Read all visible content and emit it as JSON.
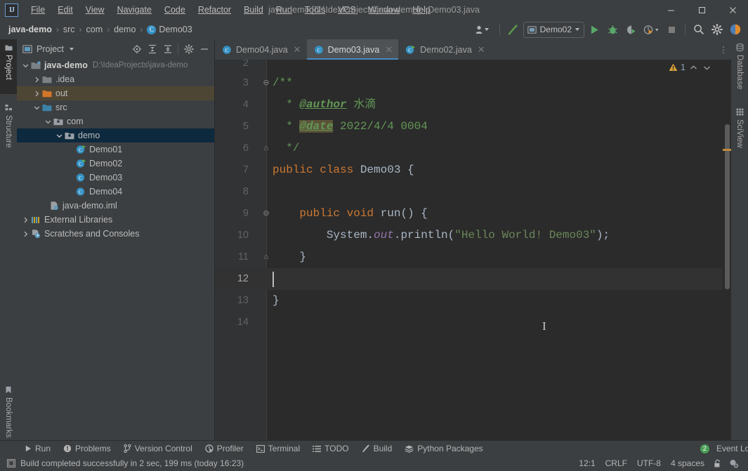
{
  "window": {
    "title": "java-demo [D:\\IdeaProjects\\java-demo] - Demo03.java",
    "minimize": "—",
    "maximize": "□",
    "close": "✕"
  },
  "menu": {
    "items": [
      {
        "label": "File"
      },
      {
        "label": "Edit"
      },
      {
        "label": "View"
      },
      {
        "label": "Navigate"
      },
      {
        "label": "Code"
      },
      {
        "label": "Refactor"
      },
      {
        "label": "Build"
      },
      {
        "label": "Run"
      },
      {
        "label": "Tools"
      },
      {
        "label": "VCS"
      },
      {
        "label": "Window"
      },
      {
        "label": "Help"
      }
    ]
  },
  "breadcrumb": {
    "separator": "›",
    "items": [
      {
        "label": "java-demo"
      },
      {
        "label": "src"
      },
      {
        "label": "com"
      },
      {
        "label": "demo"
      },
      {
        "label": "Demo03"
      }
    ]
  },
  "toolbar": {
    "run_config": "Demo02",
    "icons": [
      "user-settings-icon",
      "build-hammer-icon",
      "run-icon",
      "debug-icon",
      "run-with-coverage-icon",
      "profiler-icon",
      "stop-icon",
      "search-everywhere-icon",
      "settings-gear-icon",
      "ide-assistant-icon"
    ]
  },
  "left_stripe": {
    "items": [
      {
        "label": "Project",
        "icon": "project-folder-icon",
        "active": true
      },
      {
        "label": "Structure",
        "icon": "structure-icon",
        "active": false
      },
      {
        "label": "Bookmarks",
        "icon": "bookmark-icon",
        "active": false
      }
    ]
  },
  "right_stripe": {
    "items": [
      {
        "label": "Database",
        "icon": "database-icon"
      },
      {
        "label": "SciView",
        "icon": "sciview-grid-icon"
      }
    ]
  },
  "project_panel": {
    "title": "Project",
    "toolbar_icons": [
      "select-opened-file-icon",
      "expand-all-icon",
      "collapse-all-icon",
      "panel-settings-icon",
      "hide-panel-icon"
    ],
    "tree": [
      {
        "label": "java-demo",
        "path": "D:\\IdeaProjects\\java-demo",
        "icon": "module-folder-icon",
        "depth": 0,
        "twisty": "expanded",
        "bold": true,
        "state": "normal"
      },
      {
        "label": ".idea",
        "icon": "folder-icon",
        "depth": 1,
        "twisty": "collapsed",
        "state": "normal"
      },
      {
        "label": "out",
        "icon": "folder-orange-icon",
        "depth": 1,
        "twisty": "collapsed",
        "state": "out"
      },
      {
        "label": "src",
        "icon": "source-folder-icon",
        "depth": 1,
        "twisty": "expanded",
        "state": "normal"
      },
      {
        "label": "com",
        "icon": "package-icon",
        "depth": 2,
        "twisty": "expanded",
        "state": "normal"
      },
      {
        "label": "demo",
        "icon": "package-icon",
        "depth": 3,
        "twisty": "expanded",
        "state": "selected"
      },
      {
        "label": "Demo01",
        "icon": "runnable-class-icon",
        "depth": 4,
        "twisty": "none",
        "state": "normal"
      },
      {
        "label": "Demo02",
        "icon": "runnable-class-icon",
        "depth": 4,
        "twisty": "none",
        "state": "normal"
      },
      {
        "label": "Demo03",
        "icon": "class-icon",
        "depth": 4,
        "twisty": "none",
        "state": "normal"
      },
      {
        "label": "Demo04",
        "icon": "class-icon",
        "depth": 4,
        "twisty": "none",
        "state": "normal"
      },
      {
        "label": "java-demo.iml",
        "icon": "iml-file-icon",
        "depth": 2,
        "twisty": "none",
        "state": "normal"
      },
      {
        "label": "External Libraries",
        "icon": "libraries-icon",
        "depth": 0,
        "twisty": "collapsed",
        "state": "normal"
      },
      {
        "label": "Scratches and Consoles",
        "icon": "scratches-icon",
        "depth": 0,
        "twisty": "collapsed",
        "state": "normal"
      }
    ]
  },
  "editor": {
    "tabs": [
      {
        "label": "Demo04.java",
        "icon": "class-icon",
        "active": false,
        "close": "✕"
      },
      {
        "label": "Demo03.java",
        "icon": "class-icon",
        "active": true,
        "close": "✕"
      },
      {
        "label": "Demo02.java",
        "icon": "runnable-class-icon",
        "active": false,
        "close": "✕"
      }
    ],
    "tabs_overflow": "⋮",
    "inspection": {
      "warning_count": "1",
      "up": "⌃",
      "down": "⌄"
    },
    "caret_line": 12,
    "lines": [
      {
        "num": "2",
        "fold": "",
        "segments": []
      },
      {
        "num": "3",
        "fold": "⊖",
        "segments": [
          {
            "t": "/**",
            "c": "cmt"
          }
        ]
      },
      {
        "num": "4",
        "fold": "",
        "segments": [
          {
            "t": "  * ",
            "c": "cmt"
          },
          {
            "t": "@author",
            "c": "cmt-tag"
          },
          {
            "t": " 水滴",
            "c": "cmt"
          }
        ]
      },
      {
        "num": "5",
        "fold": "",
        "segments": [
          {
            "t": "  * ",
            "c": "cmt"
          },
          {
            "t": "@date",
            "c": "cmt-tag cmt-hl"
          },
          {
            "t": " 2022/4/4 0004",
            "c": "cmt"
          }
        ]
      },
      {
        "num": "6",
        "fold": "⌂",
        "segments": [
          {
            "t": "  */",
            "c": "cmt"
          }
        ]
      },
      {
        "num": "7",
        "fold": "",
        "segments": [
          {
            "t": "public ",
            "c": "kw"
          },
          {
            "t": "class ",
            "c": "kw"
          },
          {
            "t": "Demo03 {",
            "c": "cls"
          }
        ]
      },
      {
        "num": "8",
        "fold": "",
        "segments": []
      },
      {
        "num": "9",
        "fold": "⊖",
        "segments": [
          {
            "t": "    ",
            "c": "plain"
          },
          {
            "t": "public ",
            "c": "kw"
          },
          {
            "t": "void ",
            "c": "kw"
          },
          {
            "t": "run() {",
            "c": "cls"
          }
        ]
      },
      {
        "num": "10",
        "fold": "",
        "segments": [
          {
            "t": "        System.",
            "c": "cn"
          },
          {
            "t": "out",
            "c": "fld"
          },
          {
            "t": ".println(",
            "c": "cn"
          },
          {
            "t": "\"Hello World! Demo03\"",
            "c": "str"
          },
          {
            "t": ");",
            "c": "cn"
          }
        ]
      },
      {
        "num": "11",
        "fold": "⌂",
        "segments": [
          {
            "t": "    }",
            "c": "plain"
          }
        ]
      },
      {
        "num": "12",
        "fold": "",
        "segments": []
      },
      {
        "num": "13",
        "fold": "",
        "segments": [
          {
            "t": "}",
            "c": "plain"
          }
        ]
      },
      {
        "num": "14",
        "fold": "",
        "segments": []
      }
    ]
  },
  "tool_windows": {
    "items": [
      {
        "label": "Run",
        "icon": "run-icon"
      },
      {
        "label": "Problems",
        "icon": "problems-icon"
      },
      {
        "label": "Version Control",
        "icon": "vcs-branch-icon"
      },
      {
        "label": "Profiler",
        "icon": "profiler-icon"
      },
      {
        "label": "Terminal",
        "icon": "terminal-icon"
      },
      {
        "label": "TODO",
        "icon": "todo-list-icon"
      },
      {
        "label": "Build",
        "icon": "build-hammer-icon"
      },
      {
        "label": "Python Packages",
        "icon": "python-packages-icon"
      }
    ],
    "event_log": {
      "label": "Event Log",
      "badge": "2"
    }
  },
  "status_bar": {
    "message": "Build completed successfully in 2 sec, 199 ms (today 16:23)",
    "message_icon": "build-status-icon",
    "position": "12:1",
    "line_separator": "CRLF",
    "encoding": "UTF-8",
    "indent": "4 spaces",
    "lock_icon": "read-only-lock-icon",
    "vcs_icon": "git-branch-icon"
  },
  "colors": {
    "accent_blue": "#4a88c7",
    "class_icon_blue": "#3592c4",
    "run_green": "#62b543",
    "warning_orange": "#bf8b38",
    "selection_navy": "#0d293e",
    "out_folder_olive": "#4e4635",
    "editor_bg": "#2b2b2b",
    "panel_bg": "#3c3f41"
  }
}
